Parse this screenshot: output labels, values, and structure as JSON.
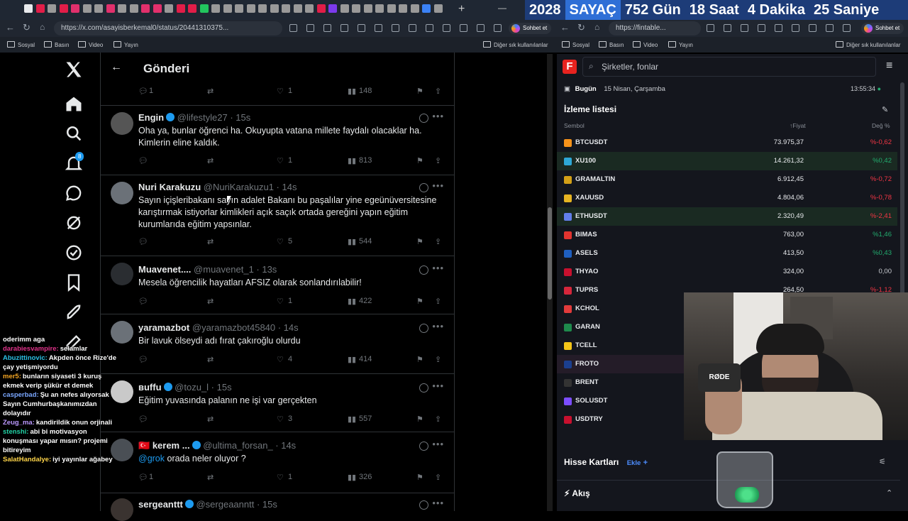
{
  "counter": {
    "year": "2028",
    "label": "SAYAÇ",
    "days": "752 Gün",
    "hours": "18 Saat",
    "minutes": "4 Dakika",
    "seconds": "25 Saniye"
  },
  "left_browser": {
    "url": "https://x.com/asayisberkemal0/status/20441310375...",
    "chat_button": "Sohbet et",
    "bookmarks": [
      "Sosyal",
      "Basın",
      "Video",
      "Yayın"
    ],
    "other_bookmarks": "Diğer sık kullanılanlar"
  },
  "right_browser": {
    "url": "https://fintable...",
    "chat_button": "Sohbet et",
    "bookmarks": [
      "Sosyal",
      "Basın",
      "Video",
      "Yayın"
    ],
    "other_bookmarks": "Diğer sık kullanılanlar"
  },
  "x": {
    "header_title": "Gönderi",
    "top_actions": {
      "replies": "1",
      "likes": "1",
      "views": "148"
    },
    "notification_count": "8",
    "tweets": [
      {
        "name": "Engin",
        "handle": "@lifestyle27 · 15s",
        "text": "Oha ya, bunlar öğrenci ha. Okuyupta vatana millete faydalı olacaklar ha. Kimlerin eline kaldık.",
        "likes": "1",
        "views": "813"
      },
      {
        "name": "Nuri Karakuzu",
        "handle": "@NuriKarakuzu1 · 14s",
        "text": "Sayın içişleribakanı sayın adalet Bakanı bu paşalılar yine egeünüversitesine karıştırmak istiyorlar kimlikleri açık saçık ortada gereğini yapın  eğitim kurumlarıda eğitim yapsınlar.",
        "likes": "5",
        "views": "544"
      },
      {
        "name": "Muavenet....",
        "handle": "@muavenet_1 · 13s",
        "text": "Mesela öğrencilik hayatları AFSIZ olarak sonlandırılabilir!",
        "likes": "1",
        "views": "422"
      },
      {
        "name": "yaramazbot",
        "handle": "@yaramazbot45840 · 14s",
        "text": "Bir lavuk ölseydi adı fırat çakıroğlu olurdu",
        "likes": "4",
        "views": "414"
      },
      {
        "name": "ʙuffu",
        "handle": "@tozu_l · 15s",
        "text": "Eğitim yuvasında palanın ne işi var gerçekten",
        "likes": "3",
        "views": "557"
      },
      {
        "name": "kerem ...",
        "handle": "@ultima_forsan_ · 14s",
        "mention": "@grok",
        "text": " orada neler oluyor ?",
        "replies": "1",
        "likes": "1",
        "views": "326"
      },
      {
        "name": "sergeanttt",
        "handle": "@sergeaanntt · 15s"
      }
    ]
  },
  "chat": [
    {
      "user": "",
      "msg": "oderimm aga"
    },
    {
      "user": "darabiesvampire:",
      "msg": "selamlar",
      "color": "#e0338a"
    },
    {
      "user": "Abuzittinovic:",
      "msg": "Akpden önce Rize'de çay yetişmiyordu",
      "color": "#2bc0e4"
    },
    {
      "user": "mer5:",
      "msg": "bunların siyaseti 3 kuruş ekmek verip şükür et demek",
      "color": "#f5a623"
    },
    {
      "user": "casperbad:",
      "msg": "Şu an nefes alıyorsak Sayın Cumhurbaşkanımızdan dolayıdır",
      "color": "#7aa7ff"
    },
    {
      "user": "Zeug_ma:",
      "msg": "kandirildik onun orjinali",
      "color": "#b9f"
    },
    {
      "user": "stenshi:",
      "msg": "abi bi motivasyon konuşması yapar mısın? projemi bitireyim",
      "color": "#22d3a6"
    },
    {
      "user": "SalatHandalye:",
      "msg": "iyi yayınlar ağabey",
      "color": "#ffd54a"
    }
  ],
  "fintable": {
    "search_placeholder": "Şirketler, fonlar",
    "today_label": "Bugün",
    "date": "15 Nisan, Çarşamba",
    "time": "13:55:34",
    "watchlist_title": "İzleme listesi",
    "col_symbol": "Sembol",
    "col_price": "↑Fiyat",
    "col_change": "Değ %",
    "rows": [
      {
        "sym": "BTCUSDT",
        "price": "73.975,37",
        "change": "%-0,62",
        "dir": "neg",
        "color": "#f7931a"
      },
      {
        "sym": "XU100",
        "price": "14.261,32",
        "change": "%0,42",
        "dir": "pos",
        "color": "#2ea8d6"
      },
      {
        "sym": "GRAMALTIN",
        "price": "6.912,45",
        "change": "%-0,72",
        "dir": "neg",
        "color": "#d4a017"
      },
      {
        "sym": "XAUUSD",
        "price": "4.804,06",
        "change": "%-0,78",
        "dir": "neg",
        "color": "#e6b422"
      },
      {
        "sym": "ETHUSDT",
        "price": "2.320,49",
        "change": "%-2,41",
        "dir": "neg",
        "color": "#627eea"
      },
      {
        "sym": "BIMAS",
        "price": "763,00",
        "change": "%1,46",
        "dir": "pos",
        "color": "#e3342f"
      },
      {
        "sym": "ASELS",
        "price": "413,50",
        "change": "%0,43",
        "dir": "pos",
        "color": "#1f5fbf"
      },
      {
        "sym": "THYAO",
        "price": "324,00",
        "change": "0,00",
        "dir": "neu",
        "color": "#c8102e"
      },
      {
        "sym": "TUPRS",
        "price": "264,50",
        "change": "%-1,12",
        "dir": "neg",
        "color": "#d6263b"
      },
      {
        "sym": "KCHOL",
        "price": "",
        "change": "",
        "dir": "neu",
        "color": "#e23b3b"
      },
      {
        "sym": "GARAN",
        "price": "",
        "change": "",
        "dir": "neu",
        "color": "#1e8a4c"
      },
      {
        "sym": "TCELL",
        "price": "",
        "change": "",
        "dir": "neu",
        "color": "#f5c518"
      },
      {
        "sym": "FROTO",
        "price": "",
        "change": "",
        "dir": "neu",
        "color": "#1b3f8f"
      },
      {
        "sym": "BRENT",
        "price": "",
        "change": "",
        "dir": "neu",
        "color": "#333"
      },
      {
        "sym": "SOLUSDT",
        "price": "",
        "change": "",
        "dir": "neu",
        "color": "#7c4dff"
      },
      {
        "sym": "USDTRY",
        "price": "",
        "change": "",
        "dir": "neu",
        "color": "#c8102e"
      }
    ],
    "cards_title": "Hisse Kartları",
    "cards_add": "Ekle",
    "flow_title": "Akış"
  },
  "webcam": {
    "mic_brand": "RØDE"
  }
}
